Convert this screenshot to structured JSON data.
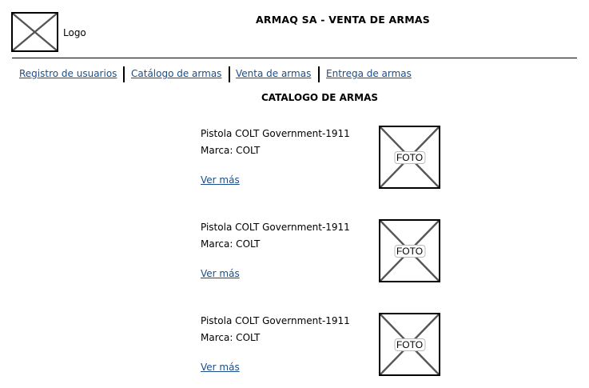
{
  "header": {
    "logo_label": "Logo",
    "title": "ARMAQ SA - VENTA DE ARMAS"
  },
  "nav": [
    {
      "label": "Registro de usuarios"
    },
    {
      "label": "Catálogo de armas"
    },
    {
      "label": "Venta de armas"
    },
    {
      "label": "Entrega de armas"
    }
  ],
  "section_title": "CATALOGO DE ARMAS",
  "items": [
    {
      "name": "Pistola COLT Government-1911",
      "brand": "Marca: COLT",
      "link": "Ver más",
      "photo_label": "FOTO"
    },
    {
      "name": "Pistola COLT Government-1911",
      "brand": "Marca: COLT",
      "link": "Ver más",
      "photo_label": "FOTO"
    },
    {
      "name": "Pistola COLT Government-1911",
      "brand": "Marca: COLT",
      "link": "Ver más",
      "photo_label": "FOTO"
    }
  ],
  "colors": {
    "link": "#1a4e8c",
    "placeholder_cross": "#555555"
  }
}
